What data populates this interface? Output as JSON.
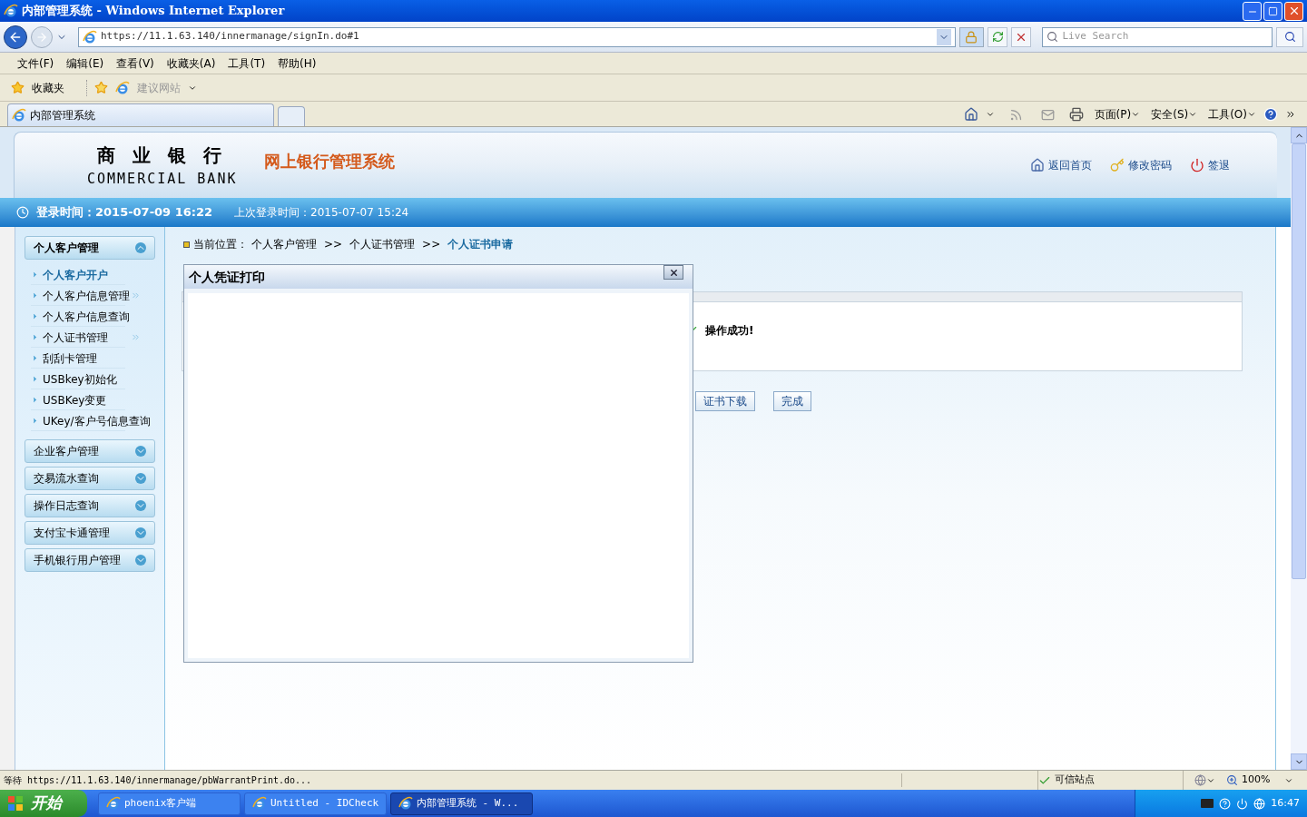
{
  "window": {
    "title": "内部管理系统 - Windows Internet Explorer"
  },
  "address_bar": {
    "url": "https://11.1.63.140/innermanage/signIn.do#1"
  },
  "search": {
    "placeholder": "Live Search"
  },
  "menu_bar": [
    "文件(F)",
    "编辑(E)",
    "查看(V)",
    "收藏夹(A)",
    "工具(T)",
    "帮助(H)"
  ],
  "favorites_bar": {
    "favorites": "收藏夹",
    "suggested": "建议网站"
  },
  "tabs": [
    {
      "label": "内部管理系统",
      "selected": true
    }
  ],
  "command_bar": [
    "页面(P)",
    "安全(S)",
    "工具(O)"
  ],
  "header": {
    "logo_cn": "商 业 银 行",
    "logo_en": "COMMERCIAL BANK",
    "system_title": "网上银行管理系统",
    "links": [
      {
        "kind": "home",
        "label": "返回首页"
      },
      {
        "kind": "key",
        "label": "修改密码"
      },
      {
        "kind": "logout",
        "label": "签退"
      }
    ]
  },
  "login_bar": {
    "login_time": "登录时间：2015-07-09 16:22",
    "last_login": "上次登录时间：2015-07-07 15:24"
  },
  "sidebar": {
    "sections": [
      {
        "label": "个人客户管理",
        "expanded": true,
        "children": [
          {
            "label": "个人客户开户",
            "selected": true,
            "submenu": false
          },
          {
            "label": "个人客户信息管理",
            "selected": false,
            "submenu": true
          },
          {
            "label": "个人客户信息查询",
            "selected": false,
            "submenu": false
          },
          {
            "label": "个人证书管理",
            "selected": false,
            "submenu": true
          },
          {
            "label": "刮刮卡管理",
            "selected": false,
            "submenu": false
          },
          {
            "label": "USBkey初始化",
            "selected": false,
            "submenu": false
          },
          {
            "label": "USBKey变更",
            "selected": false,
            "submenu": false
          },
          {
            "label": "UKey/客户号信息查询",
            "selected": false,
            "submenu": false
          }
        ]
      },
      {
        "label": "企业客户管理",
        "expanded": false
      },
      {
        "label": "交易流水查询",
        "expanded": false
      },
      {
        "label": "操作日志查询",
        "expanded": false
      },
      {
        "label": "支付宝卡通管理",
        "expanded": false
      },
      {
        "label": "手机银行用户管理",
        "expanded": false
      }
    ]
  },
  "breadcrumb": {
    "prefix": "当前位置：",
    "separator": ">>",
    "items": [
      {
        "label": "个人客户管理",
        "current": false
      },
      {
        "label": "个人证书管理",
        "current": false
      },
      {
        "label": "个人证书申请",
        "current": true
      }
    ]
  },
  "result": {
    "message": "操作成功!",
    "buttons": [
      "证书下载",
      "完成"
    ]
  },
  "dialog": {
    "title": "个人凭证打印"
  },
  "status_bar": {
    "text": "等待 https://11.1.63.140/innermanage/pbWarrantPrint.do...",
    "zone": "可信站点",
    "zoom": "100%"
  },
  "taskbar": {
    "start": "开始",
    "buttons": [
      {
        "label": "phoenix客户端",
        "selected": false
      },
      {
        "label": "Untitled - IDCheck",
        "selected": false
      },
      {
        "label": "内部管理系统 - W...",
        "selected": true
      }
    ],
    "clock": "16:47"
  }
}
